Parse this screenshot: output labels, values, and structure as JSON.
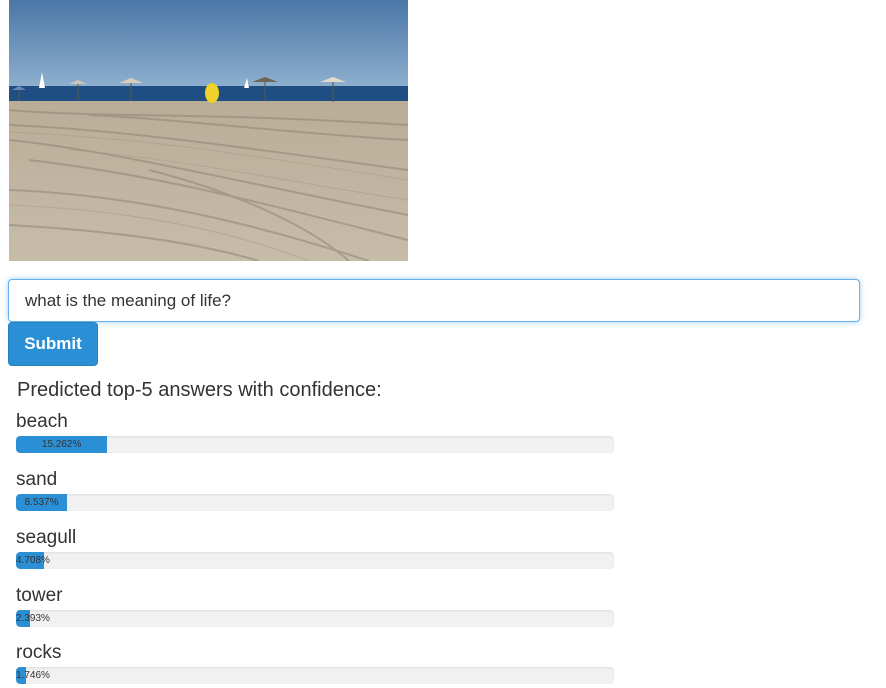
{
  "image": {
    "alt": "beach",
    "colors": {
      "sky": "#4f7ba9",
      "sea": "#1f4f82",
      "sand": "#c2b6a1"
    }
  },
  "question": {
    "value": "what is the meaning of life?"
  },
  "submit": {
    "label": "Submit"
  },
  "results": {
    "heading": "Predicted top-5 answers with confidence:",
    "answers": [
      {
        "label": "beach",
        "confidence_text": "15.262%",
        "confidence": 15.262
      },
      {
        "label": "sand",
        "confidence_text": "8.537%",
        "confidence": 8.537
      },
      {
        "label": "seagull",
        "confidence_text": "4.708%",
        "confidence": 4.708
      },
      {
        "label": "tower",
        "confidence_text": "2.393%",
        "confidence": 2.393
      },
      {
        "label": "rocks",
        "confidence_text": "1.746%",
        "confidence": 1.746
      }
    ]
  },
  "colors": {
    "accent": "#2b8fd6",
    "track": "#f1f1f1",
    "focus": "#66afe9"
  }
}
